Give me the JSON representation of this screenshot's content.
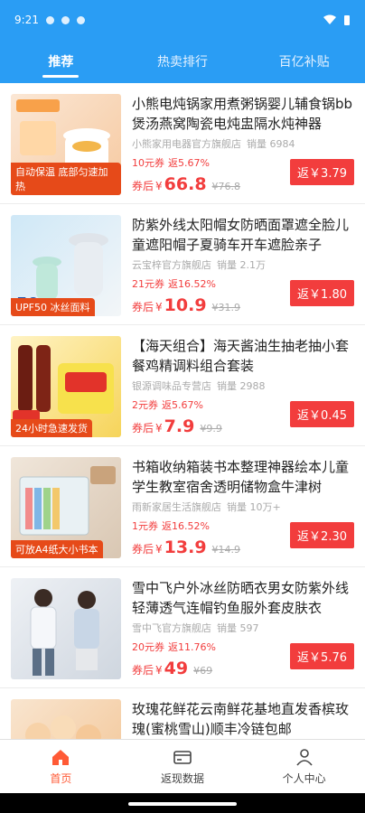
{
  "status": {
    "time": "9:21"
  },
  "tabs": [
    {
      "label": "推荐"
    },
    {
      "label": "热卖排行"
    },
    {
      "label": "百亿补贴"
    }
  ],
  "products": [
    {
      "title": "小熊电炖锅家用煮粥锅婴儿辅食锅bb煲汤燕窝陶瓷电炖盅隔水炖神器",
      "shop": "小熊家用电器官方旗舰店",
      "sales": "销量 6984",
      "coupon": "10元券",
      "rebate_pct": "返5.67%",
      "price_label": "券后",
      "currency": "¥",
      "price": "66.8",
      "original": "¥76.8",
      "rebate_btn": "返￥3.79",
      "thumb_tag": "自动保温 底部匀速加热"
    },
    {
      "title": "防紫外线太阳帽女防晒面罩遮全脸儿童遮阳帽子夏骑车开车遮脸亲子",
      "shop": "云宝梓官方旗舰店",
      "sales": "销量 2.1万",
      "coupon": "21元券",
      "rebate_pct": "返16.52%",
      "price_label": "券后",
      "currency": "¥",
      "price": "10.9",
      "original": "¥31.9",
      "rebate_btn": "返￥1.80",
      "thumb_tag": "UPF50 冰丝面料"
    },
    {
      "title": "【海天组合】海天酱油生抽老抽小套餐鸡精调料组合套装",
      "shop": "银源调味品专营店",
      "sales": "销量 2988",
      "coupon": "2元券",
      "rebate_pct": "返5.67%",
      "price_label": "券后",
      "currency": "¥",
      "price": "7.9",
      "original": "¥9.9",
      "rebate_btn": "返￥0.45",
      "thumb_tag": "24小时急速发货"
    },
    {
      "title": "书箱收纳箱装书本整理神器绘本儿童学生教室宿舍透明储物盒牛津树",
      "shop": "雨新家居生活旗舰店",
      "sales": "销量 10万+",
      "coupon": "1元券",
      "rebate_pct": "返16.52%",
      "price_label": "券后",
      "currency": "¥",
      "price": "13.9",
      "original": "¥14.9",
      "rebate_btn": "返￥2.30",
      "thumb_tag": "可放A4纸大小书本"
    },
    {
      "title": "雪中飞户外冰丝防晒衣男女防紫外线轻薄透气连帽钓鱼服外套皮肤衣",
      "shop": "雪中飞官方旗舰店",
      "sales": "销量 597",
      "coupon": "20元券",
      "rebate_pct": "返11.76%",
      "price_label": "券后",
      "currency": "¥",
      "price": "49",
      "original": "¥69",
      "rebate_btn": "返￥5.76",
      "thumb_tag": ""
    },
    {
      "title": "玫瑰花鲜花云南鲜花基地直发香槟玫瑰(蜜桃雪山)顺丰冷链包邮",
      "shop": "",
      "sales": "",
      "coupon": "",
      "rebate_pct": "",
      "price_label": "",
      "currency": "",
      "price": "",
      "original": "",
      "rebate_btn": "",
      "thumb_tag": ""
    }
  ],
  "nav": [
    {
      "label": "首页",
      "icon": "home-icon"
    },
    {
      "label": "返现数据",
      "icon": "card-icon"
    },
    {
      "label": "个人中心",
      "icon": "person-icon"
    }
  ],
  "colors": {
    "primary": "#2a9df4",
    "accent": "#f23d3d",
    "nav_active": "#ff5a36"
  }
}
